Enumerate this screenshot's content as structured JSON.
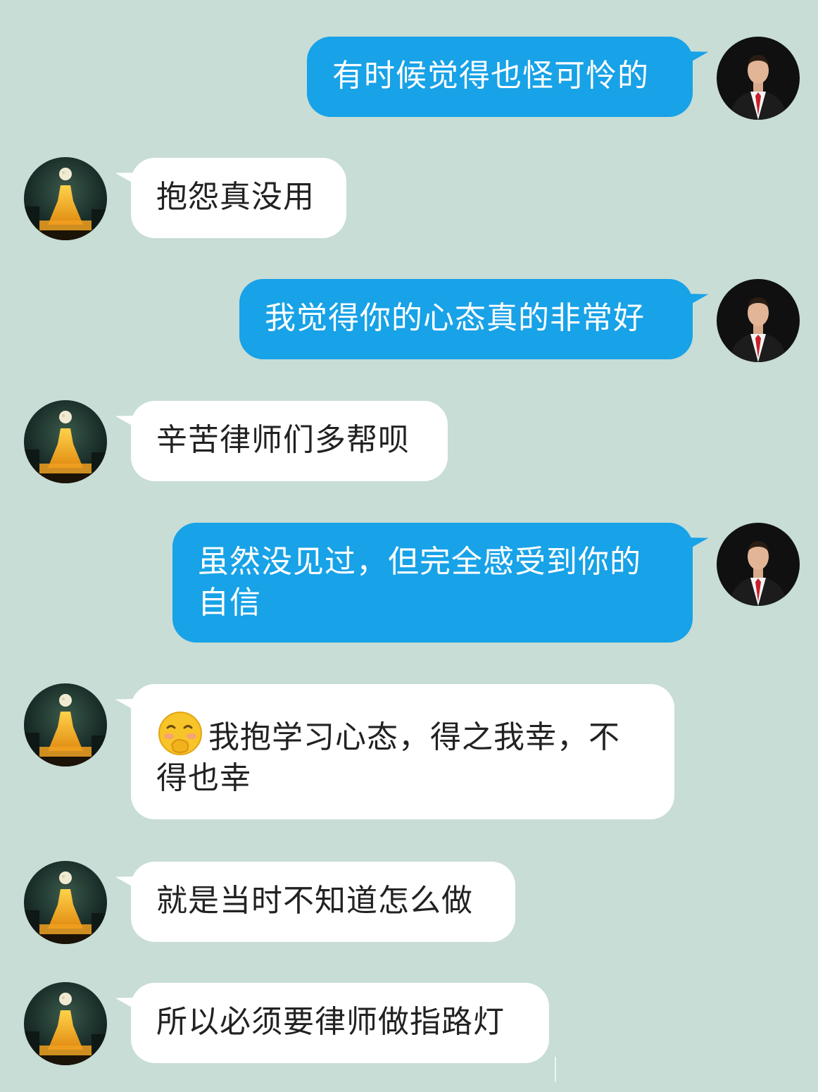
{
  "chat": {
    "background_color": "#c7ddd6",
    "outgoing_bubble_color": "#18a2e7",
    "incoming_bubble_color": "#ffffff",
    "messages": [
      {
        "sender": "me",
        "text": "有时候觉得也怪可怜的",
        "avatar_icon": "lawyer-portrait-avatar"
      },
      {
        "sender": "contact",
        "text": "抱怨真没用",
        "avatar_icon": "night-tower-moon-avatar"
      },
      {
        "sender": "me",
        "text": "我觉得你的心态真的非常好",
        "avatar_icon": "lawyer-portrait-avatar"
      },
      {
        "sender": "contact",
        "text": "辛苦律师们多帮呗",
        "avatar_icon": "night-tower-moon-avatar"
      },
      {
        "sender": "me",
        "text": "虽然没见过，但完全感受到你的自信",
        "avatar_icon": "lawyer-portrait-avatar"
      },
      {
        "sender": "contact",
        "text": "我抱学习心态，得之我幸，不得也幸",
        "emoji": "shy-smile-emoji",
        "avatar_icon": "night-tower-moon-avatar"
      },
      {
        "sender": "contact",
        "text": "就是当时不知道怎么做",
        "avatar_icon": "night-tower-moon-avatar"
      },
      {
        "sender": "contact",
        "text": "所以必须要律师做指路灯",
        "avatar_icon": "night-tower-moon-avatar"
      }
    ]
  }
}
